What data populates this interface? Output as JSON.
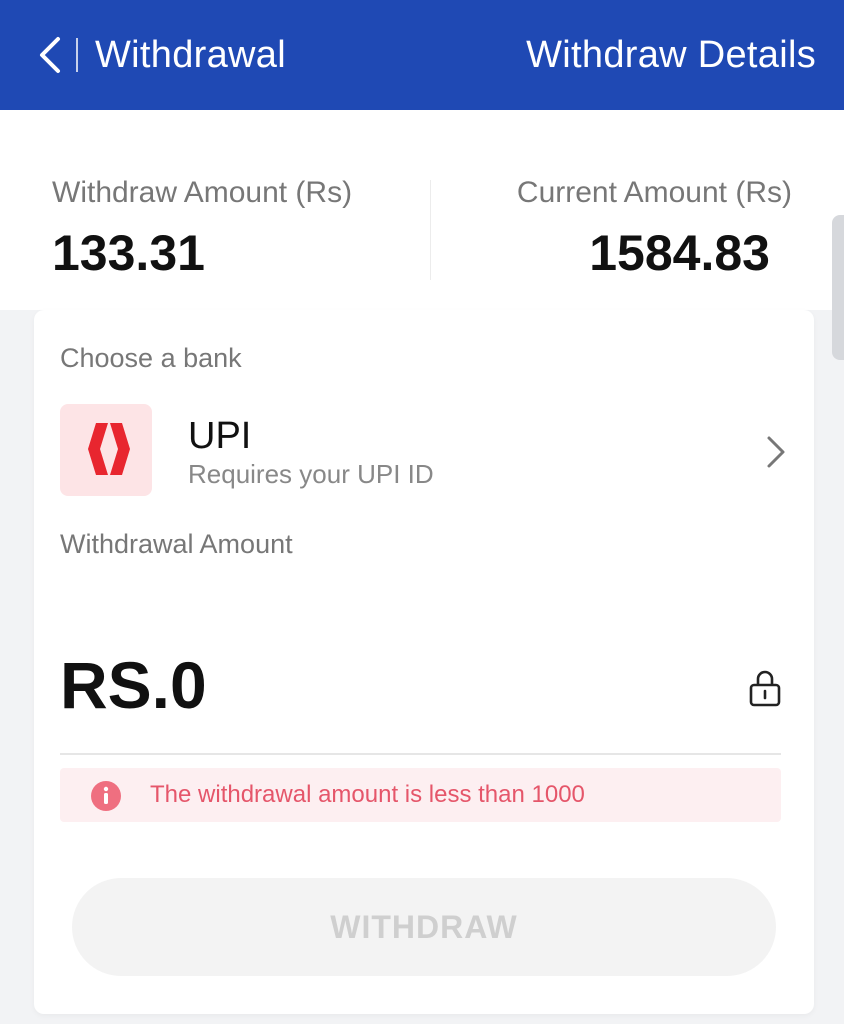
{
  "header": {
    "title": "Withdrawal",
    "right_link": "Withdraw Details",
    "bg_color": "#1f49b4"
  },
  "summary": {
    "withdraw_label": "Withdraw Amount (Rs)",
    "withdraw_value": "133.31",
    "current_label": "Current Amount (Rs)",
    "current_value": "1584.83"
  },
  "bank": {
    "section_label": "Choose a bank",
    "name": "UPI",
    "description": "Requires your UPI ID",
    "logo_icon": "upi-logo-icon"
  },
  "amount": {
    "label": "Withdrawal Amount",
    "value": "RS.0"
  },
  "warning": {
    "text": "The withdrawal amount is less than 1000",
    "color": "#e5566a"
  },
  "withdraw_button": {
    "label": "WITHDRAW"
  }
}
